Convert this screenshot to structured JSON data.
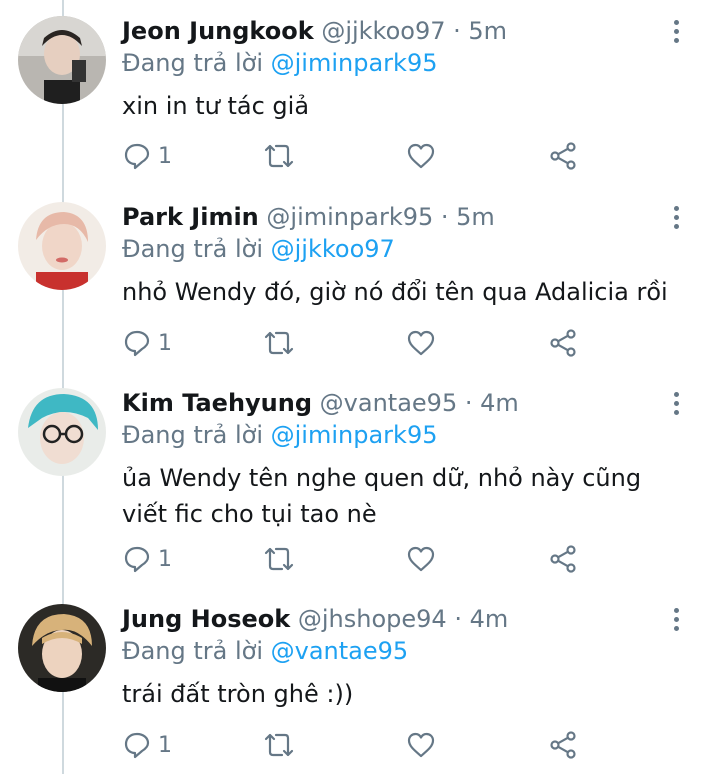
{
  "tweets": [
    {
      "name": "Jeon Jungkook",
      "handle": "@jjkkoo97",
      "time": "· 5m",
      "reply_prefix": "Đang trả lời ",
      "reply_to": "@jiminpark95",
      "text": "xin in tư tác giả",
      "reply_count": "1"
    },
    {
      "name": "Park Jimin",
      "handle": "@jiminpark95",
      "time": "· 5m",
      "reply_prefix": "Đang trả lời ",
      "reply_to": "@jjkkoo97",
      "text": "nhỏ Wendy đó, giờ nó đổi tên qua Adalicia rồi",
      "reply_count": "1"
    },
    {
      "name": "Kim Taehyung",
      "handle": "@vantae95",
      "time": "· 4m",
      "reply_prefix": "Đang trả lời ",
      "reply_to": "@jiminpark95",
      "text": "ủa Wendy tên nghe quen dữ, nhỏ này cũng viết fic cho tụi tao nè",
      "reply_count": "1"
    },
    {
      "name": "Jung Hoseok",
      "handle": "@jhshope94",
      "time": "· 4m",
      "reply_prefix": "Đang trả lời ",
      "reply_to": "@vantae95",
      "text": "trái đất tròn ghê :))",
      "reply_count": "1"
    }
  ],
  "colors": {
    "text": "#14171a",
    "secondary": "#657786",
    "mention": "#1da1f2",
    "thread_line": "#cfd9de"
  },
  "icons": [
    "reply-icon",
    "retweet-icon",
    "like-icon",
    "share-icon",
    "more-icon"
  ]
}
